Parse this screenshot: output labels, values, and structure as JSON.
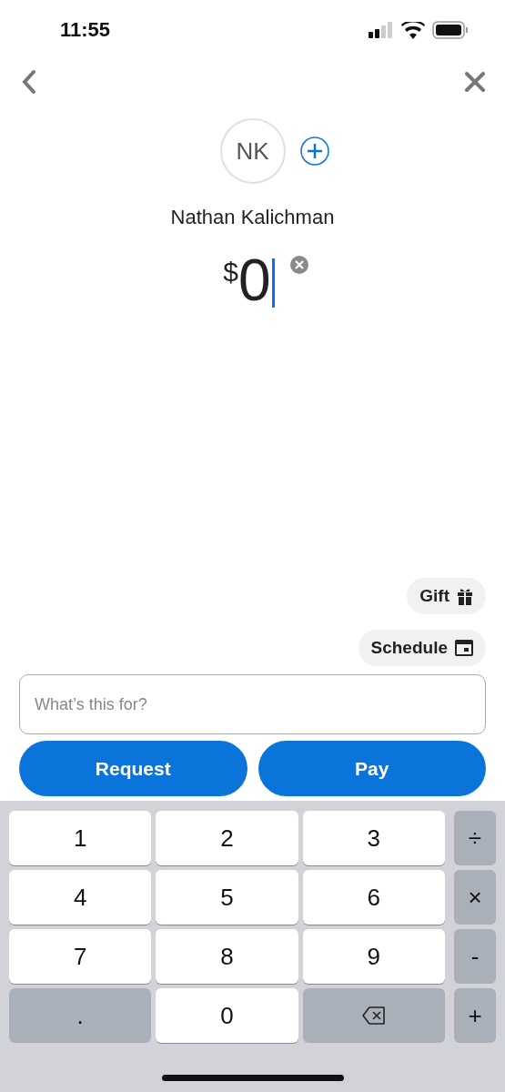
{
  "status_bar": {
    "time": "11:55"
  },
  "recipient": {
    "initials": "NK",
    "name": "Nathan Kalichman"
  },
  "amount": {
    "currency": "$",
    "value": "0"
  },
  "chips": [
    {
      "label": "Gift",
      "kind": "gift"
    },
    {
      "label": "Schedule",
      "kind": "schedule"
    }
  ],
  "note_field": {
    "placeholder": "What’s this for?"
  },
  "actions": [
    {
      "label": "Request"
    },
    {
      "label": "Pay"
    }
  ],
  "keyboard": {
    "rows": [
      [
        {
          "label": "1",
          "kind": "digit"
        },
        {
          "label": "2",
          "kind": "digit"
        },
        {
          "label": "3",
          "kind": "digit"
        },
        {
          "label": "÷",
          "kind": "operator"
        }
      ],
      [
        {
          "label": "4",
          "kind": "digit"
        },
        {
          "label": "5",
          "kind": "digit"
        },
        {
          "label": "6",
          "kind": "digit"
        },
        {
          "label": "×",
          "kind": "operator"
        }
      ],
      [
        {
          "label": "7",
          "kind": "digit"
        },
        {
          "label": "8",
          "kind": "digit"
        },
        {
          "label": "9",
          "kind": "digit"
        },
        {
          "label": "-",
          "kind": "operator"
        }
      ],
      [
        {
          "label": ".",
          "kind": "function"
        },
        {
          "label": "0",
          "kind": "digit"
        },
        {
          "kind": "backspace"
        },
        {
          "label": "+",
          "kind": "operator"
        }
      ]
    ]
  }
}
